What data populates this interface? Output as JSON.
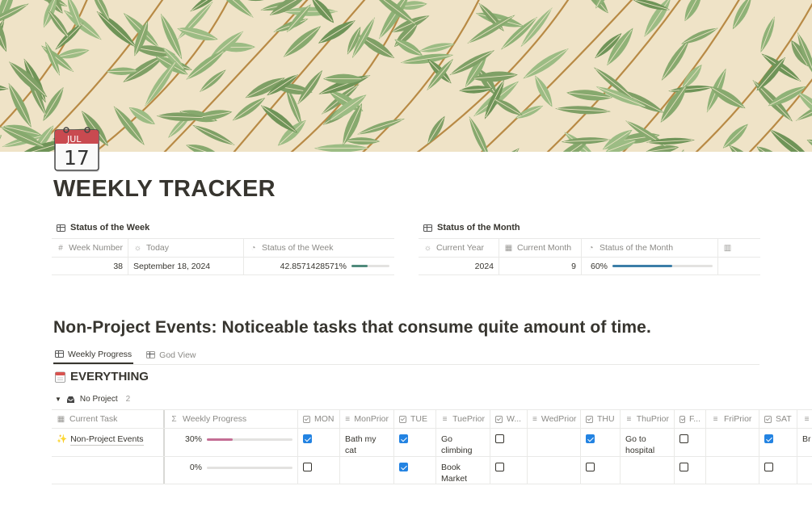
{
  "page": {
    "title": "WEEKLY TRACKER",
    "icon": "calendar-icon",
    "icon_month": "JUL",
    "icon_day": "17"
  },
  "week_status": {
    "title": "Status of the Week",
    "headers": {
      "week_number": "Week Number",
      "today": "Today",
      "status": "Status of the Week"
    },
    "row": {
      "week_number": "38",
      "today": "September 18, 2024",
      "status": "42.8571428571%",
      "status_progress": 0.4286
    }
  },
  "month_status": {
    "title": "Status of the Month",
    "headers": {
      "year": "Current Year",
      "month": "Current Month",
      "status": "Status of the Month"
    },
    "row": {
      "year": "2024",
      "month": "9",
      "status": "60%",
      "status_progress": 0.6
    }
  },
  "section": {
    "title": "Non-Project Events: Noticeable tasks that consume quite amount of time."
  },
  "views": {
    "weekly_progress": "Weekly Progress",
    "god_view": "God View"
  },
  "board": {
    "heading": "EVERYTHING",
    "group": {
      "name": "No Project",
      "count": "2"
    },
    "headers": {
      "task": "Current Task",
      "progress": "Weekly Progress",
      "mon": "MON",
      "monprior": "MonPrior",
      "tue": "TUE",
      "tueprior": "TuePrior",
      "wed": "W...",
      "wedprior": "WedPrior",
      "thu": "THU",
      "thuprior": "ThuPrior",
      "fri": "F...",
      "friprior": "FriPrior",
      "sat": "SAT"
    },
    "rows": [
      {
        "task": "Non-Project Events",
        "task_emoji": "✨",
        "progress": "30%",
        "progress_value": 0.3,
        "mon": true,
        "monprior": "Bath my cat",
        "tue": true,
        "tueprior": "Go climbing",
        "wed": false,
        "wedprior": "",
        "thu": true,
        "thuprior": "Go to hospital",
        "fri": false,
        "friprior": "",
        "sat": true,
        "satprior": "Br pa"
      },
      {
        "task": "",
        "task_emoji": "",
        "progress": "0%",
        "progress_value": 0,
        "mon": false,
        "monprior": "",
        "tue": true,
        "tueprior": "Book Market",
        "wed": false,
        "wedprior": "",
        "thu": false,
        "thuprior": "",
        "fri": false,
        "friprior": "",
        "sat": false,
        "satprior": ""
      }
    ]
  },
  "colors": {
    "week_bar": "#4f8a7b",
    "month_bar": "#3c7ea8",
    "progress_bar": "#c46e95",
    "checkbox": "#2383e2",
    "cover_bg": "#efe3c7",
    "leaf": "#86a86d",
    "stem": "#b88a45"
  }
}
